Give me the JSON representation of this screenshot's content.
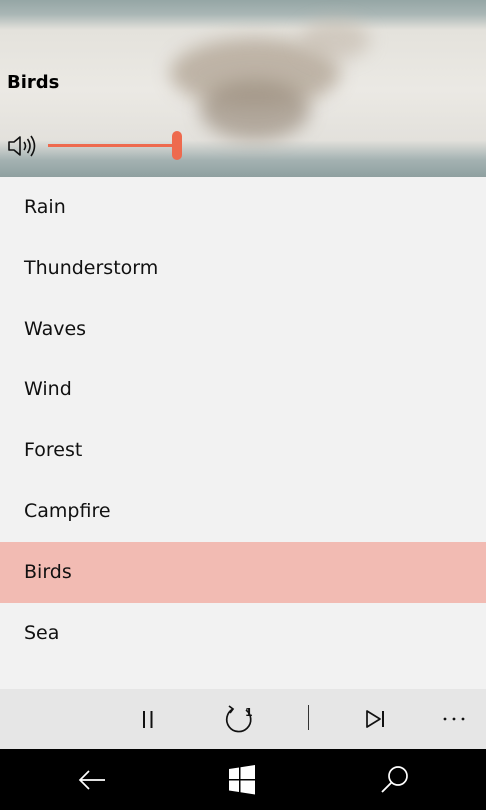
{
  "now_playing": {
    "title": "Birds",
    "volume_fraction": 0.97
  },
  "sounds": [
    {
      "label": "Rain",
      "selected": false
    },
    {
      "label": "Thunderstorm",
      "selected": false
    },
    {
      "label": "Waves",
      "selected": false
    },
    {
      "label": "Wind",
      "selected": false
    },
    {
      "label": "Forest",
      "selected": false
    },
    {
      "label": "Campfire",
      "selected": false
    },
    {
      "label": "Birds",
      "selected": true
    },
    {
      "label": "Sea",
      "selected": false
    }
  ],
  "controls": {
    "repeat_count": "1",
    "icons": [
      "pause-icon",
      "repeat-once-icon",
      "skip-next-icon",
      "more-icon"
    ]
  },
  "nav": {
    "icons": [
      "back-arrow-icon",
      "windows-logo-icon",
      "search-icon"
    ]
  },
  "colors": {
    "accent": "#ee6a4e",
    "selected_row": "#f2bbb3",
    "list_bg": "#f2f2f2",
    "app_bar": "#e6e6e6",
    "nav_bar": "#000000"
  }
}
